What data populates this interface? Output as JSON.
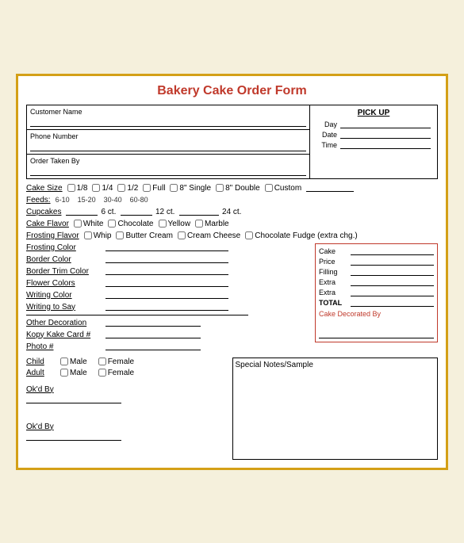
{
  "title": "Bakery Cake Order Form",
  "pickup": {
    "label": "PICK UP",
    "day_label": "Day",
    "date_label": "Date",
    "time_label": "Time"
  },
  "fields": {
    "customer_name": "Customer Name",
    "phone_number": "Phone Number",
    "order_taken_by": "Order Taken By"
  },
  "cake_size": {
    "label": "Cake Size",
    "options": [
      "1/8",
      "1/4",
      "1/2",
      "Full",
      "8\" Single",
      "8\" Double",
      "Custom"
    ]
  },
  "feeds": {
    "label": "Feeds:",
    "ranges": [
      "6-10",
      "15-20",
      "30-40",
      "60-80"
    ]
  },
  "cupcakes": {
    "label": "Cupcakes",
    "quantities": [
      "6 ct.",
      "12 ct.",
      "24 ct."
    ]
  },
  "cake_flavor": {
    "label": "Cake Flavor",
    "options": [
      "White",
      "Chocolate",
      "Yellow",
      "Marble"
    ]
  },
  "frosting_flavor": {
    "label": "Frosting Flavor",
    "options": [
      "Whip",
      "Butter Cream",
      "Cream Cheese",
      "Chocolate Fudge (extra chg.)"
    ]
  },
  "frosting_color": {
    "label": "Frosting Color"
  },
  "border_color": {
    "label": "Border Color"
  },
  "border_trim_color": {
    "label": "Border Trim Color"
  },
  "flower_colors": {
    "label": "Flower Colors"
  },
  "writing_color": {
    "label": "Writing Color"
  },
  "writing_to_say": {
    "label": "Writing to Say"
  },
  "other_decoration": {
    "label": "Other Decoration"
  },
  "kopy_kake": {
    "label": "Kopy Kake Card #"
  },
  "photo": {
    "label": "Photo #"
  },
  "right_box": {
    "cake_price": "Cake",
    "price": "Price",
    "filling": "Filling",
    "extra1": "Extra",
    "extra2": "Extra",
    "total": "TOTAL",
    "decorated_by": "Cake Decorated By"
  },
  "child": {
    "label": "Child",
    "male": "Male",
    "female": "Female"
  },
  "adult": {
    "label": "Adult",
    "male": "Male",
    "female": "Female"
  },
  "special_notes": "Special Notes/Sample",
  "okd_by": "Ok'd By"
}
